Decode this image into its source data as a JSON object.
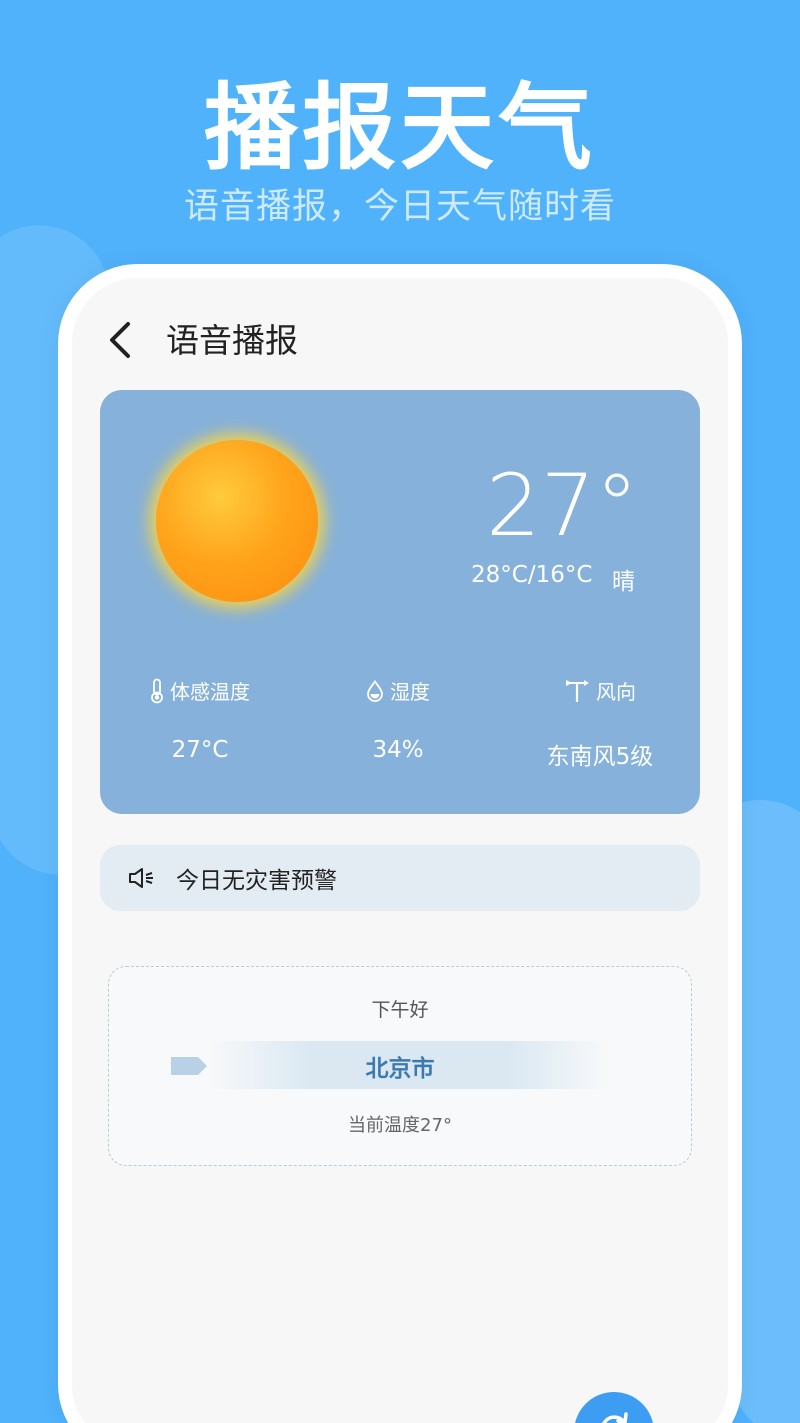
{
  "promo": {
    "title": "播报天气",
    "subtitle": "语音播报，今日天气随时看"
  },
  "header": {
    "title": "语音播报",
    "back_icon": "chevron-left-icon"
  },
  "weather": {
    "current_temp": "27°",
    "range": "28°C/16°C",
    "condition": "晴",
    "icon": "sun-icon",
    "metrics": [
      {
        "label": "体感温度",
        "value": "27°C",
        "icon": "thermometer-icon"
      },
      {
        "label": "湿度",
        "value": "34%",
        "icon": "droplet-icon"
      },
      {
        "label": "风向",
        "value": "东南风5级",
        "icon": "wind-vane-icon"
      }
    ]
  },
  "alert": {
    "text": "今日无灾害预警",
    "icon": "speaker-icon"
  },
  "broadcast": {
    "greeting": "下午好",
    "city": "北京市",
    "current_temp_text": "当前温度27°"
  },
  "colors": {
    "background": "#4fb2fb",
    "card": "#86b1da",
    "accent": "#3b79b2"
  }
}
